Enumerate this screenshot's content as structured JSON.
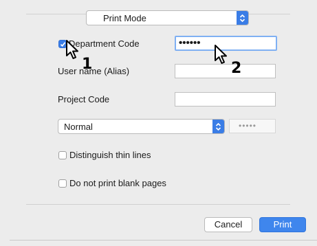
{
  "print_mode": {
    "value": "Print Mode"
  },
  "department_code": {
    "checkbox_label": "Department Code",
    "checked": true,
    "value": "••••••"
  },
  "user_name": {
    "label": "User name (Alias)",
    "value": ""
  },
  "project_code": {
    "label": "Project Code",
    "value": ""
  },
  "print_type": {
    "value": "Normal",
    "password_value": "•••••"
  },
  "options": {
    "thin_lines_label": "Distinguish thin lines",
    "thin_lines_checked": false,
    "blank_pages_label": "Do not print blank pages",
    "blank_pages_checked": false
  },
  "buttons": {
    "cancel": "Cancel",
    "print": "Print"
  },
  "callouts": {
    "step1": "1",
    "step2": "2"
  },
  "colors": {
    "accent": "#3a7de6",
    "background": "#ececec"
  }
}
